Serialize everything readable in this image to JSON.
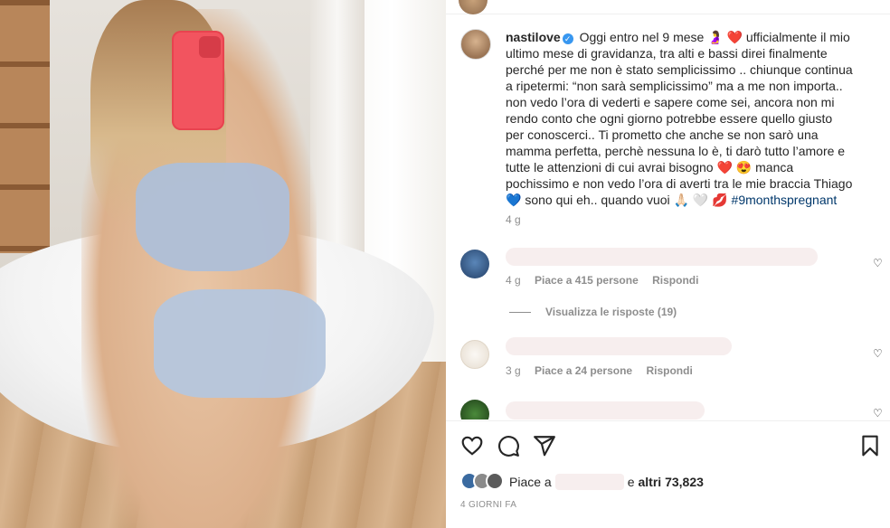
{
  "post": {
    "username": "nastilove",
    "caption_lines": [
      " Oggi entro nel 9 mese 🤰 ❤️ ufficialmente il mio",
      "ultimo mese di gravidanza, tra alti e bassi direi finalmente",
      "perché per me non è stato semplicissimo .. chiunque continua",
      "a ripetermi: “non sarà semplicissimo” ma a me non importa..",
      "non vedo l’ora di vederti e sapere come sei, ancora non mi",
      "rendo conto che ogni giorno potrebbe essere quello giusto",
      "per conoscerci.. Ti prometto che anche se non sarò una",
      "mamma perfetta, perchè nessuna lo è, ti darò tutto l’amore e",
      "tutte le attenzioni di cui avrai bisogno ❤️ 😍 manca",
      "pochissimo e non vedo l’ora di averti tra le mie braccia Thiago",
      "💙 sono qui eh.. quando vuoi 🙏🏻 🤍 💋 "
    ],
    "hashtag": "#9monthspregnant",
    "time": "4 g"
  },
  "comments": [
    {
      "time": "4 g",
      "likes": "Piace a 415 persone",
      "reply": "Rispondi"
    },
    {
      "time": "3 g",
      "likes": "Piace a 24 persone",
      "reply": "Rispondi"
    }
  ],
  "view_replies": "Visualizza le risposte (19)",
  "likes_summary": {
    "prefix": "Piace a",
    "suffix": "e",
    "others": "altri 73,823"
  },
  "date": "4 GIORNI FA",
  "icons": [
    "heart-icon",
    "comment-icon",
    "share-icon",
    "bookmark-icon",
    "verified-icon"
  ],
  "colors": {
    "link": "#00376b",
    "verified": "#3897f0",
    "muted": "#8e8e8e"
  }
}
